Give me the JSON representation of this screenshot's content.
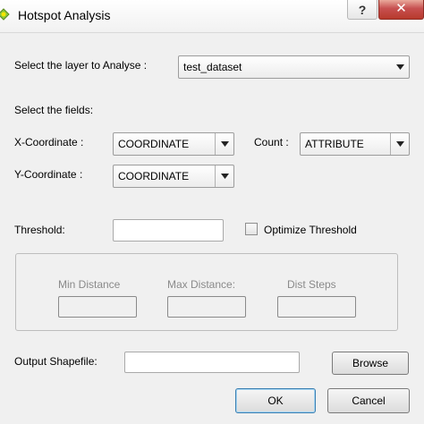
{
  "window": {
    "title": "Hotspot Analysis",
    "help_label": "?",
    "close_label": "✕",
    "close_color": "#c75050"
  },
  "layer": {
    "label": "Select the layer to Analyse :",
    "value": "test_dataset"
  },
  "fields": {
    "section_label": "Select the fields:",
    "x_label": "X-Coordinate :",
    "x_value": "COORDINATE",
    "y_label": "Y-Coordinate :",
    "y_value": "COORDINATE",
    "count_label": "Count :",
    "count_value": "ATTRIBUTE"
  },
  "threshold": {
    "label": "Threshold:",
    "value": "",
    "optimize_label": "Optimize Threshold",
    "optimize_checked": false
  },
  "distance_group": {
    "min_label": "Min Distance",
    "max_label": "Max Distance:",
    "steps_label": "Dist Steps",
    "min_value": "",
    "max_value": "",
    "steps_value": ""
  },
  "output": {
    "label": "Output Shapefile:",
    "value": "",
    "browse_label": "Browse"
  },
  "buttons": {
    "ok_label": "OK",
    "cancel_label": "Cancel"
  },
  "icons": {
    "app": "qgis-icon",
    "dropdown": "chevron-down-icon",
    "close": "close-icon",
    "help": "help-icon"
  }
}
